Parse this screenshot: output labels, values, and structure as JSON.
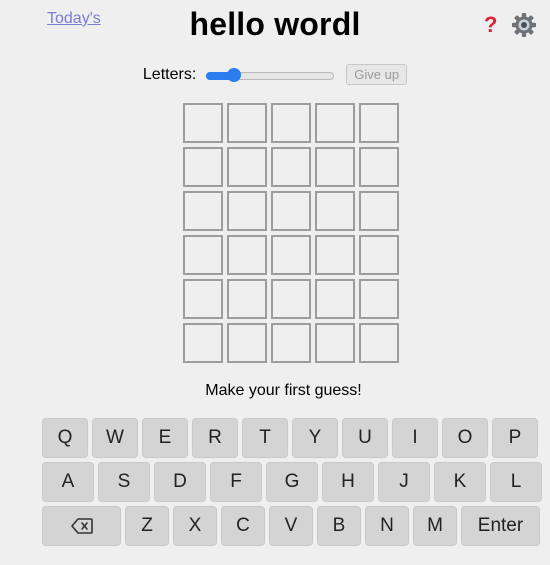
{
  "header": {
    "todays_link": "Today's",
    "title": "hello wordl",
    "help_icon": "question-mark-icon",
    "settings_icon": "gear-icon"
  },
  "controls": {
    "letters_label": "Letters:",
    "letters_slider_position": 0.18,
    "give_up_label": "Give up"
  },
  "board": {
    "rows": 6,
    "cols": 5,
    "cells": [
      [
        "",
        "",
        "",
        "",
        ""
      ],
      [
        "",
        "",
        "",
        "",
        ""
      ],
      [
        "",
        "",
        "",
        "",
        ""
      ],
      [
        "",
        "",
        "",
        "",
        ""
      ],
      [
        "",
        "",
        "",
        "",
        ""
      ],
      [
        "",
        "",
        "",
        "",
        ""
      ]
    ]
  },
  "message": "Make your first guess!",
  "keyboard": {
    "row1": [
      "Q",
      "W",
      "E",
      "R",
      "T",
      "Y",
      "U",
      "I",
      "O",
      "P"
    ],
    "row2": [
      "A",
      "S",
      "D",
      "F",
      "G",
      "H",
      "J",
      "K",
      "L"
    ],
    "row3": [
      "Z",
      "X",
      "C",
      "V",
      "B",
      "N",
      "M"
    ],
    "backspace_icon": "backspace-icon",
    "enter_label": "Enter"
  },
  "colors": {
    "accent": "#2b7df0",
    "help": "#e0213a",
    "link": "#7b7bd8",
    "key_bg": "#d4d4d4",
    "cell_border": "#9d9d9d"
  }
}
